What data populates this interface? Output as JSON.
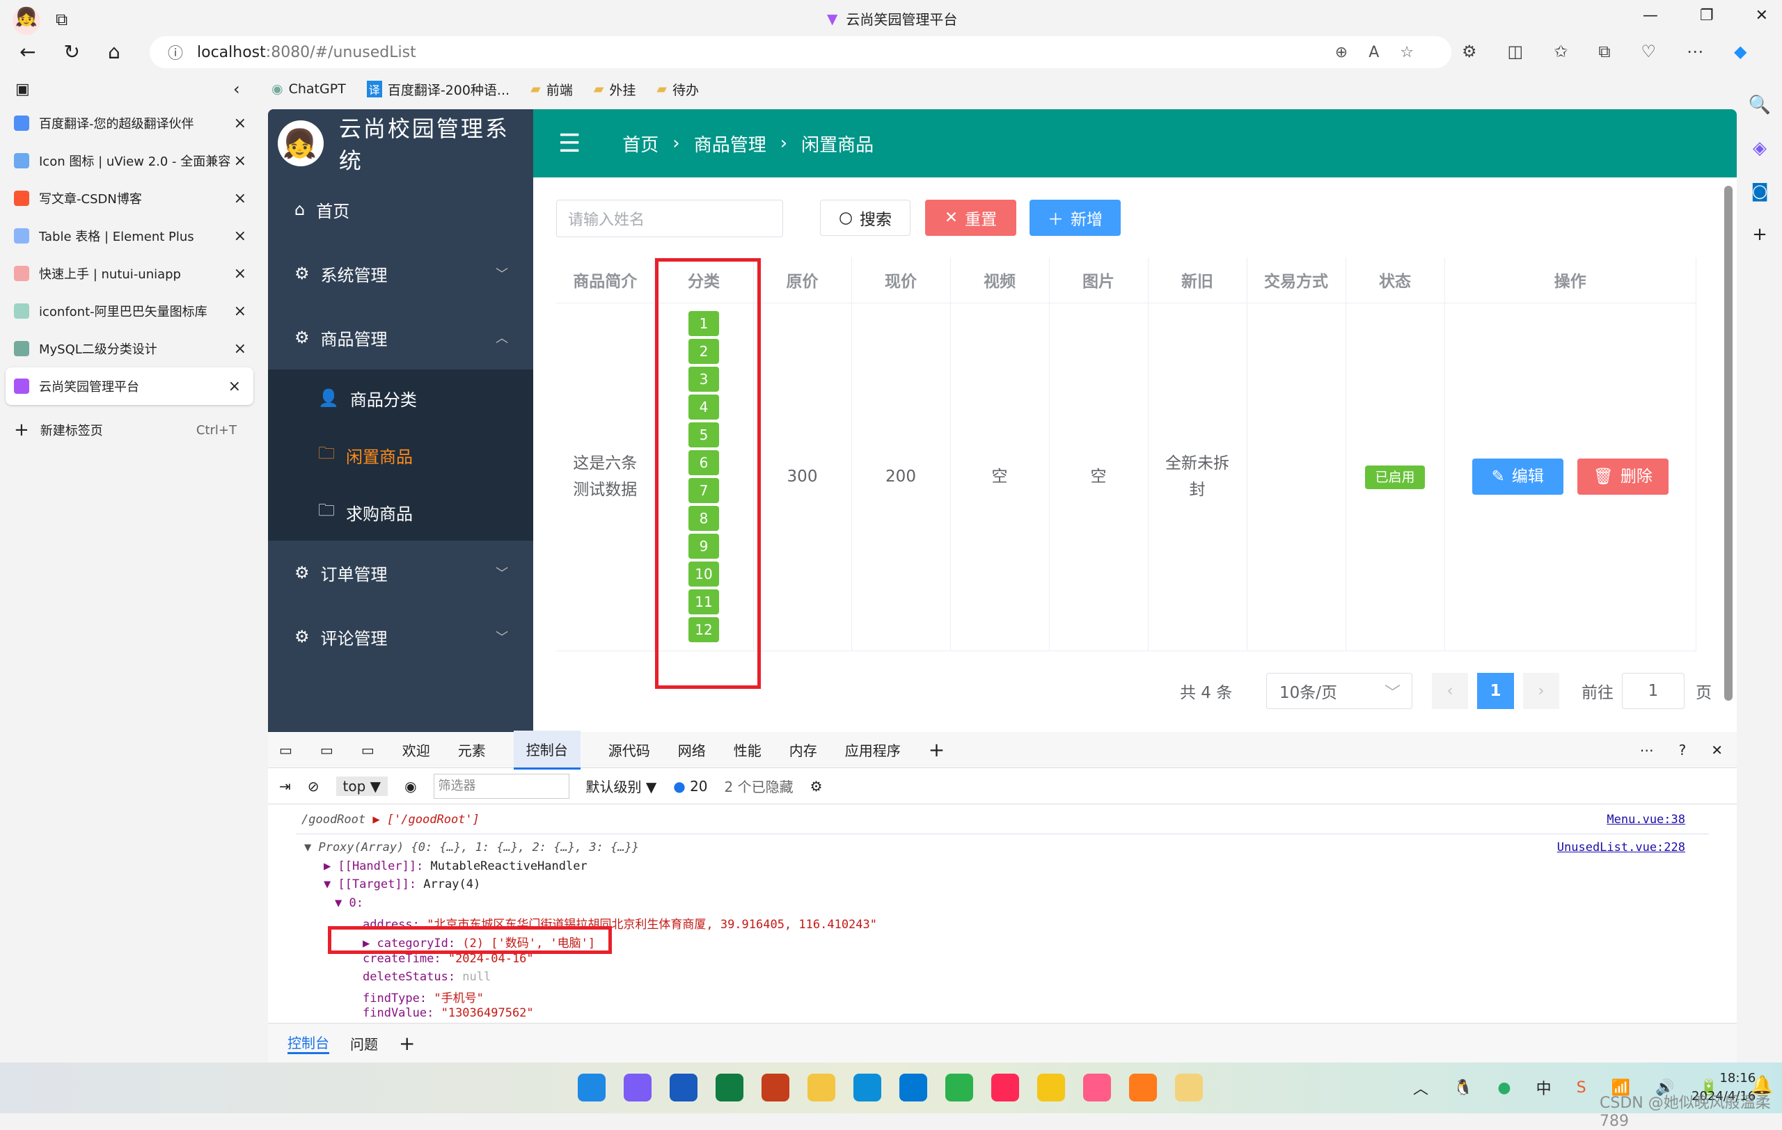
{
  "window": {
    "title": "云尚笑园管理平台"
  },
  "browser": {
    "url_host": "localhost",
    "url_rest": ":8080/#/unusedList",
    "bookmarks": [
      "ChatGPT",
      "百度翻译-200种语...",
      "前端",
      "外挂",
      "待办"
    ],
    "tabs": [
      {
        "label": "百度翻译-您的超级翻译伙伴",
        "color": "#4e8ef7"
      },
      {
        "label": "Icon 图标 | uView 2.0 - 全面兼容",
        "color": "#6aa8f0"
      },
      {
        "label": "写文章-CSDN博客",
        "color": "#fc5531"
      },
      {
        "label": "Table 表格 | Element Plus",
        "color": "#8ab4f8"
      },
      {
        "label": "快速上手 | nutui-uniapp",
        "color": "#f4a6a6"
      },
      {
        "label": "iconfont-阿里巴巴矢量图标库",
        "color": "#9cd3c5"
      },
      {
        "label": "MySQL二级分类设计",
        "color": "#74aa9c"
      },
      {
        "label": "云尚笑园管理平台",
        "color": "#a855f7"
      }
    ],
    "new_tab": "新建标签页",
    "new_tab_shortcut": "Ctrl+T"
  },
  "app": {
    "logo_text": "云尚校园管理系统",
    "menu": [
      {
        "label": "首页",
        "icon": "home-icon"
      },
      {
        "label": "系统管理",
        "icon": "gear-icon"
      },
      {
        "label": "商品管理",
        "icon": "gear-icon"
      }
    ],
    "submenu": [
      {
        "label": "商品分类"
      },
      {
        "label": "闲置商品"
      },
      {
        "label": "求购商品"
      }
    ],
    "menu2": [
      {
        "label": "订单管理"
      },
      {
        "label": "评论管理"
      }
    ],
    "breadcrumb": [
      "首页",
      "商品管理",
      "闲置商品"
    ],
    "search_placeholder": "请输入姓名",
    "search_btn": "搜索",
    "reset_btn": "重置",
    "add_btn": "新增",
    "columns": [
      "商品简介",
      "分类",
      "原价",
      "现价",
      "视频",
      "图片",
      "新旧",
      "交易方式",
      "状态",
      "操作"
    ],
    "row": {
      "intro": "这是六条测试数据",
      "categories": [
        "1",
        "2",
        "3",
        "4",
        "5",
        "6",
        "7",
        "8",
        "9",
        "10",
        "11",
        "12"
      ],
      "original_price": "300",
      "price": "200",
      "video": "空",
      "image": "空",
      "condition": "全新未拆封",
      "trade": "",
      "status": "已启用",
      "edit": "编辑",
      "delete": "删除"
    },
    "pagination": {
      "total": "共 4 条",
      "page_size": "10条/页",
      "current": "1",
      "goto_label": "前往",
      "goto_value": "1",
      "page_suffix": "页"
    },
    "colors": {
      "teal": "#009688",
      "sidebar": "#304156",
      "tag": "#67c23a",
      "primary": "#409eff",
      "danger": "#f56c6c",
      "active": "#ff8c1a"
    }
  },
  "devtools": {
    "tabs": [
      "欢迎",
      "元素",
      "控制台",
      "源代码",
      "网络",
      "性能",
      "内存",
      "应用程序"
    ],
    "context": "top",
    "filter_placeholder": "筛选器",
    "level": "默认级别",
    "messages": "20",
    "hidden": "2 个已隐藏",
    "lines": [
      {
        "k": "/goodRoot ",
        "v": "▶ ['/goodRoot']",
        "src": "Menu.vue:38"
      },
      {
        "k": "▼ Proxy(Array) ",
        "v": "{0: {…}, 1: {…}, 2: {…}, 3: {…}}",
        "src": "UnusedList.vue:228"
      },
      {
        "k": "▶ [[Handler]]: ",
        "v": "MutableReactiveHandler"
      },
      {
        "k": "▼ [[Target]]: ",
        "v": "Array(4)"
      },
      {
        "k": "▼ 0:",
        "v": ""
      },
      {
        "k": "address: ",
        "v": "\"北京市东城区东华门街道锡拉胡同北京利生体育商厦, 39.916405, 116.410243\""
      },
      {
        "k": "▶ categoryId: ",
        "v": "(2) ['数码', '电脑']"
      },
      {
        "k": "createTime: ",
        "v": "\"2024-04-16\""
      },
      {
        "k": "deleteStatus: ",
        "v": "null"
      },
      {
        "k": "findType: ",
        "v": "\"手机号\""
      },
      {
        "k": "findValue: ",
        "v": "\"13036497562\""
      }
    ],
    "drawer": [
      "控制台",
      "问题"
    ]
  },
  "taskbar": {
    "time": "18:16",
    "date": "2024/4/16",
    "watermark": "CSDN @她似晚风般温柔789"
  }
}
